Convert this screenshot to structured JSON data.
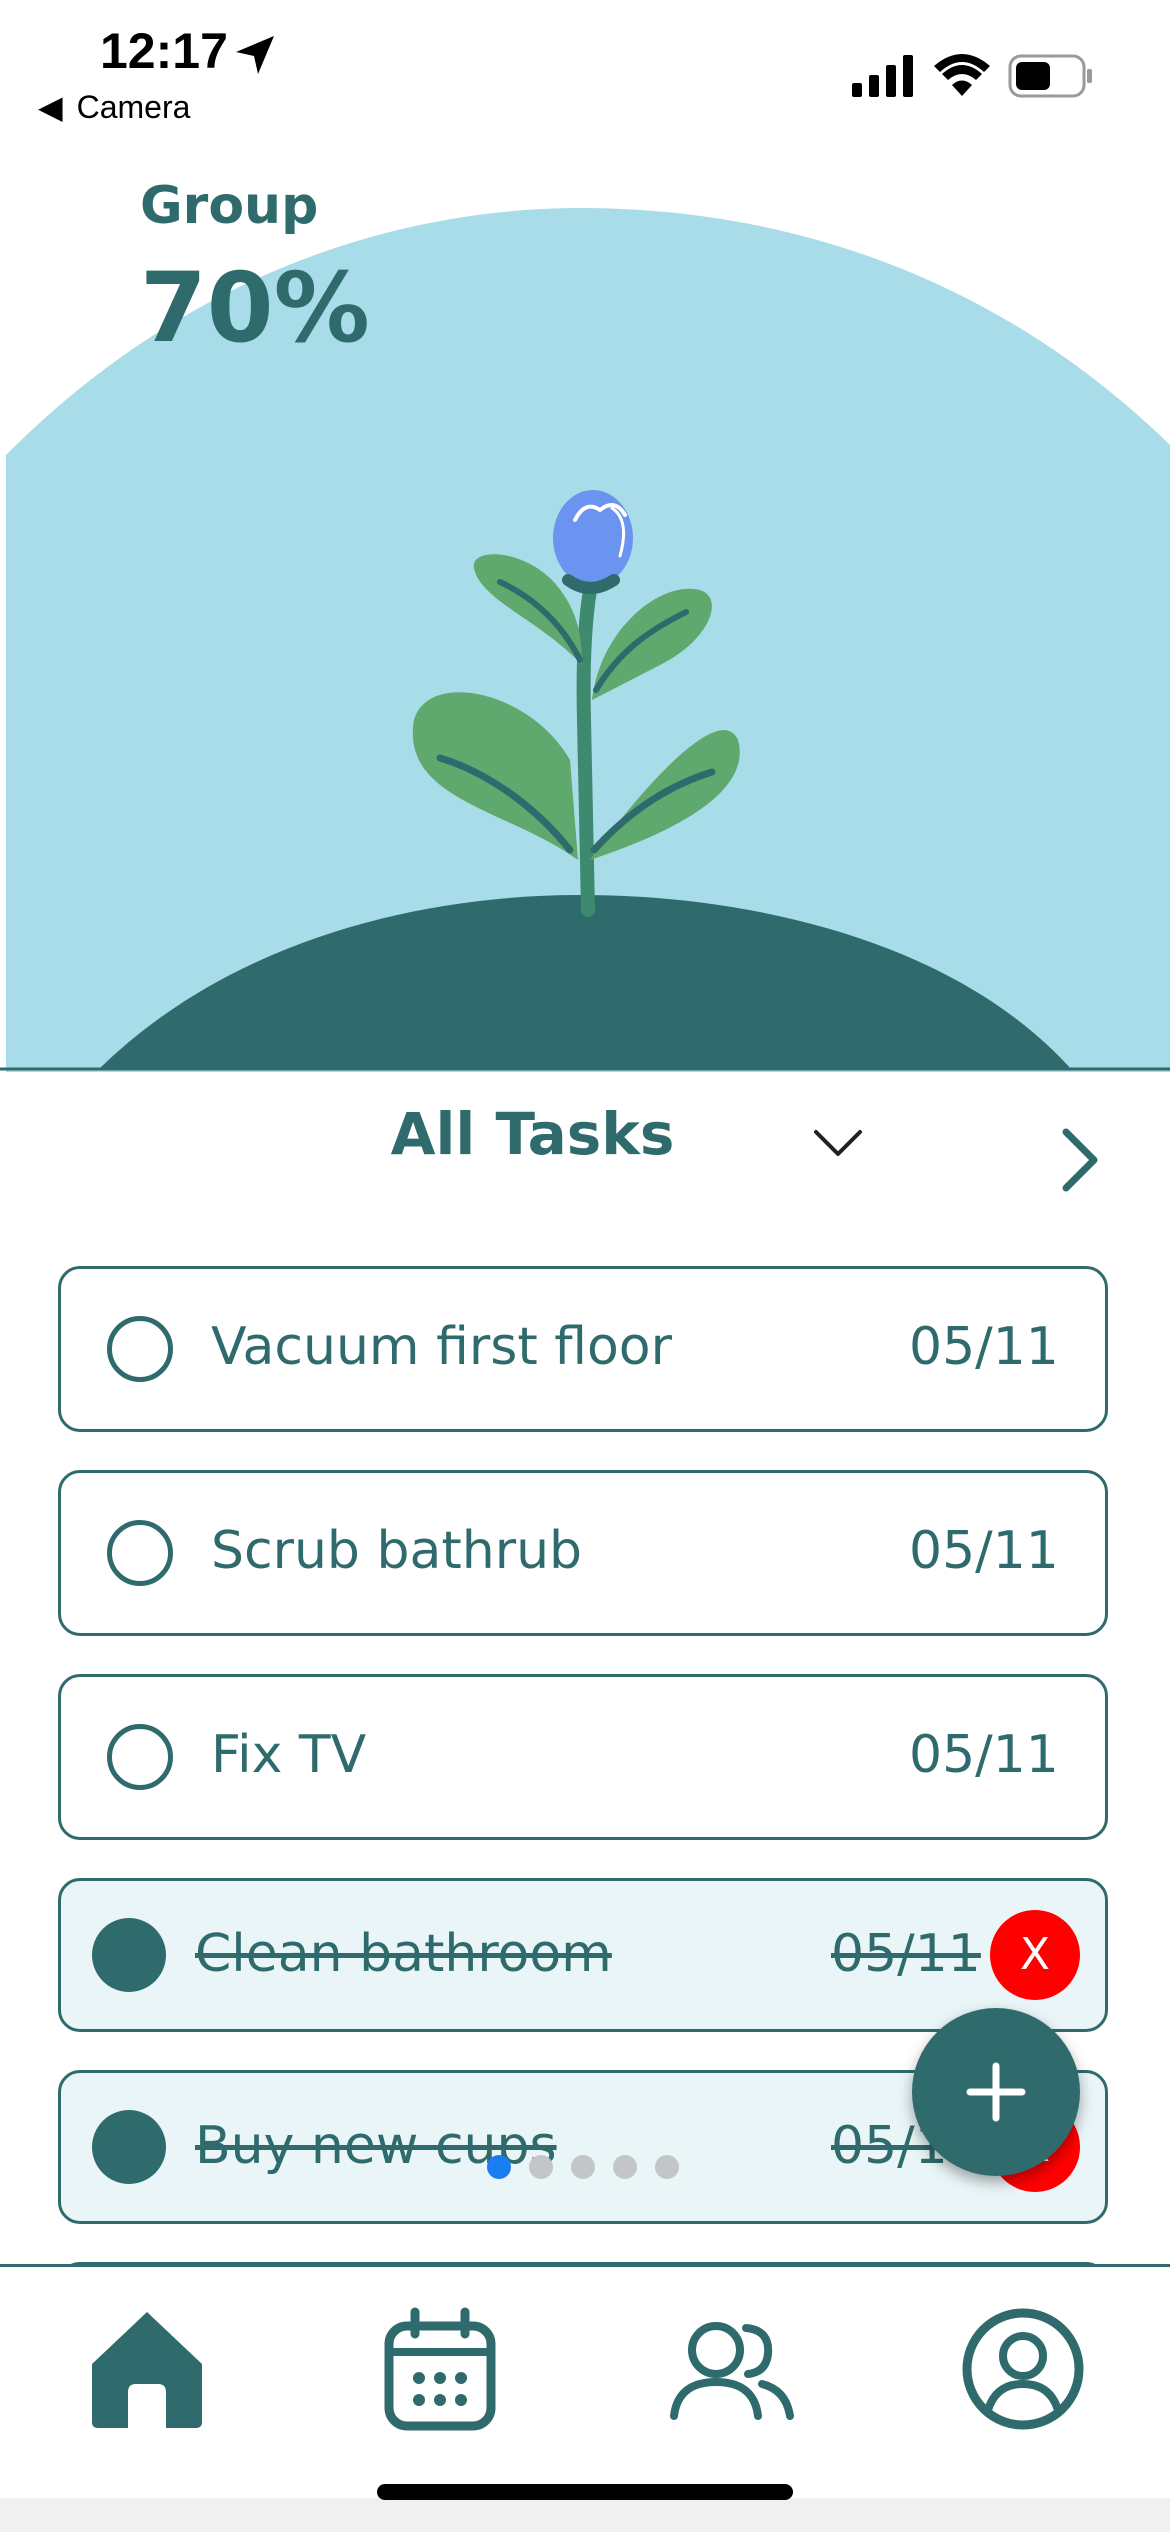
{
  "status_bar": {
    "time": "12:17",
    "back_label": "Camera",
    "back_icon": "back-triangle-icon",
    "location_icon": "location-arrow-icon",
    "signal_icon": "cellular-signal-icon",
    "wifi_icon": "wifi-icon",
    "battery_icon": "battery-icon",
    "battery_level": 0.55
  },
  "hero": {
    "label": "Group",
    "percent": "70%",
    "illustration": "plant-flower-icon",
    "colors": {
      "sky": "#a8dce9",
      "hill": "#2f6b6c",
      "leaf": "#5fa86e",
      "flower": "#6b93f0"
    }
  },
  "tasks_header": {
    "title": "All Tasks",
    "dropdown_icon": "chevron-down-icon",
    "next_icon": "chevron-right-icon"
  },
  "tasks": [
    {
      "name": "Vacuum first floor",
      "date": "05/11",
      "done": false
    },
    {
      "name": "Scrub bathrub",
      "date": "05/11",
      "done": false
    },
    {
      "name": "Fix TV",
      "date": "05/11",
      "done": false
    },
    {
      "name": "Clean bathroom",
      "date": "05/11",
      "done": true,
      "delete_label": "X"
    },
    {
      "name": "Buy new cups",
      "date": "05/11",
      "done": true,
      "delete_label": "X"
    }
  ],
  "fab": {
    "icon": "plus-icon"
  },
  "pagination": {
    "count": 5,
    "active_index": 0
  },
  "nav": {
    "items": [
      {
        "name": "home",
        "icon": "home-icon",
        "active": true
      },
      {
        "name": "calendar",
        "icon": "calendar-icon",
        "active": false
      },
      {
        "name": "group",
        "icon": "users-icon",
        "active": false
      },
      {
        "name": "profile",
        "icon": "profile-icon",
        "active": false
      }
    ]
  },
  "colors": {
    "primary": "#2f6b6c",
    "delete": "#ff0000",
    "done_bg": "#eaf5f8",
    "dot_active": "#1a7ef2",
    "dot_inactive": "#c2c6c8"
  }
}
